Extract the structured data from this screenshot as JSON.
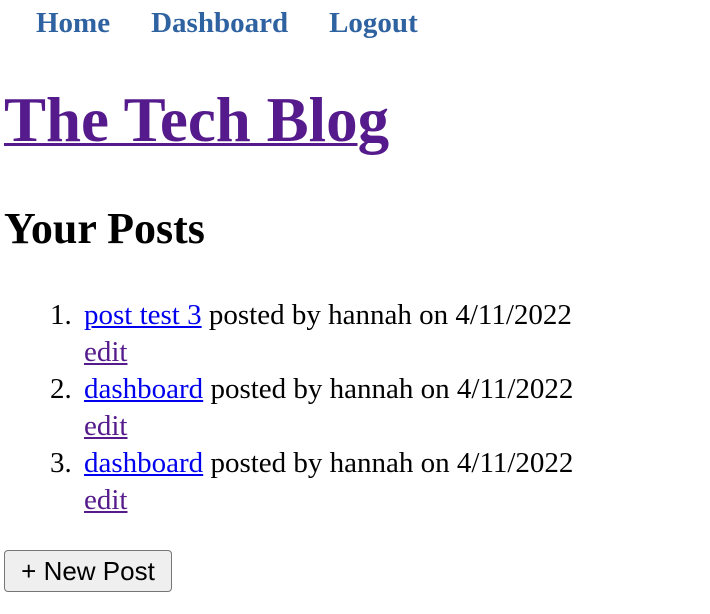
{
  "nav": {
    "items": [
      {
        "label": "Home"
      },
      {
        "label": "Dashboard"
      },
      {
        "label": "Logout"
      }
    ]
  },
  "site_title": "The Tech Blog",
  "section_title": "Your Posts",
  "posts": [
    {
      "number": "1.",
      "title": "post test 3",
      "meta": " posted by hannah on 4/11/2022",
      "edit_label": "edit"
    },
    {
      "number": "2.",
      "title": "dashboard",
      "meta": " posted by hannah on 4/11/2022",
      "edit_label": "edit"
    },
    {
      "number": "3.",
      "title": "dashboard",
      "meta": " posted by hannah on 4/11/2022",
      "edit_label": "edit"
    }
  ],
  "new_post_button": "+ New Post",
  "colors": {
    "nav_link": "#2f62a0",
    "visited_link": "#551a8b",
    "link": "#0000ee"
  }
}
